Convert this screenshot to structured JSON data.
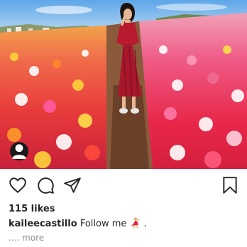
{
  "post": {
    "likes_text": "115 likes",
    "username": "kaileecastillo",
    "caption_text": " Follow me",
    "caption_suffix": " .",
    "more_text": ".... more"
  },
  "icons": {
    "like": "heart-icon",
    "comment": "comment-bubble-icon",
    "share": "paper-plane-icon",
    "save": "bookmark-icon",
    "avatar": "person-icon",
    "caption_emoji": "dancer-emoji-icon"
  },
  "colors": {
    "text": "#262626",
    "muted": "#8e8e8e",
    "sky": "#7fb6e6",
    "flower_red": "#e8243a",
    "flower_pink": "#f06b93",
    "dress": "#b81a30"
  }
}
